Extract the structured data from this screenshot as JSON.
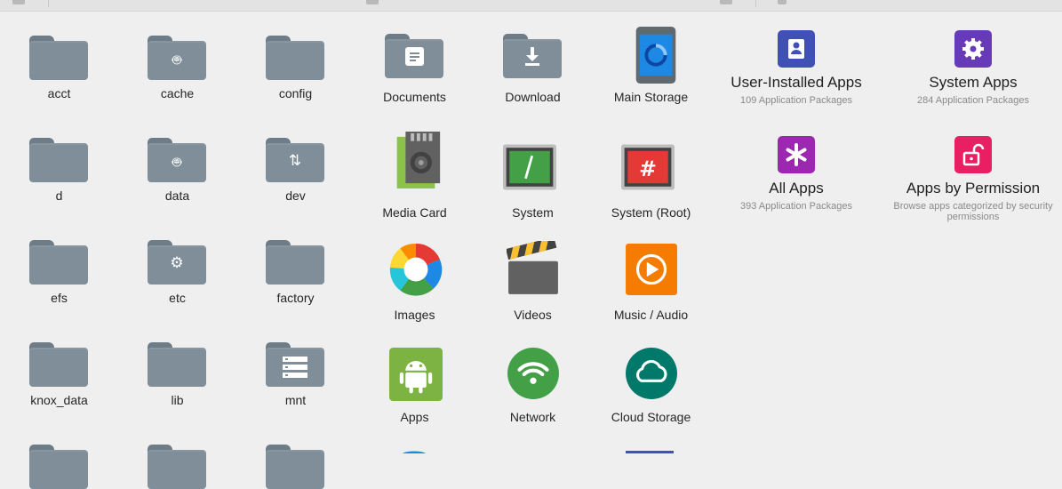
{
  "folders": [
    {
      "label": "acct",
      "glyph": ""
    },
    {
      "label": "cache",
      "glyph": "android"
    },
    {
      "label": "config",
      "glyph": ""
    },
    {
      "label": "d",
      "glyph": ""
    },
    {
      "label": "data",
      "glyph": "android"
    },
    {
      "label": "dev",
      "glyph": "arrows"
    },
    {
      "label": "efs",
      "glyph": ""
    },
    {
      "label": "etc",
      "glyph": "gear"
    },
    {
      "label": "factory",
      "glyph": ""
    },
    {
      "label": "knox_data",
      "glyph": ""
    },
    {
      "label": "lib",
      "glyph": ""
    },
    {
      "label": "mnt",
      "glyph": "list"
    }
  ],
  "locations": [
    {
      "label": "Documents",
      "icon": "documents-folder-icon"
    },
    {
      "label": "Download",
      "icon": "download-folder-icon"
    },
    {
      "label": "Main Storage",
      "icon": "phone-storage-icon"
    },
    {
      "label": "Media Card",
      "icon": "sd-card-icon"
    },
    {
      "label": "System",
      "icon": "terminal-icon"
    },
    {
      "label": "System (Root)",
      "icon": "root-terminal-icon"
    },
    {
      "label": "Images",
      "icon": "images-icon"
    },
    {
      "label": "Videos",
      "icon": "clapperboard-icon"
    },
    {
      "label": "Music / Audio",
      "icon": "play-icon"
    },
    {
      "label": "Apps",
      "icon": "android-apps-icon"
    },
    {
      "label": "Network",
      "icon": "wifi-icon"
    },
    {
      "label": "Cloud Storage",
      "icon": "cloud-icon"
    }
  ],
  "app_manager": [
    {
      "title": "User-Installed Apps",
      "subtitle": "109 Application Packages",
      "color": "#3f51b5",
      "icon": "user-icon"
    },
    {
      "title": "System Apps",
      "subtitle": "284 Application Packages",
      "color": "#673ab7",
      "icon": "gear-icon"
    },
    {
      "title": "All Apps",
      "subtitle": "393 Application Packages",
      "color": "#9c27b0",
      "icon": "asterisk-icon"
    },
    {
      "title": "Apps by Permission",
      "subtitle": "Browse apps categorized by security permissions",
      "color": "#e91e63",
      "icon": "unlock-icon"
    }
  ],
  "colors": {
    "folder": "#7f8e98",
    "background": "#efefef"
  }
}
